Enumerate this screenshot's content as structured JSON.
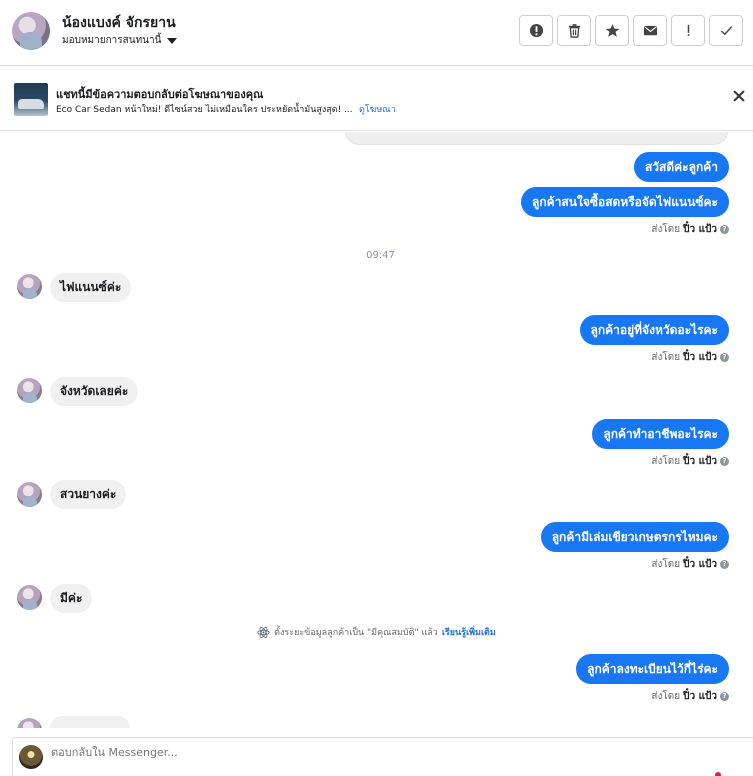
{
  "header": {
    "name": "น้องแบงค์ จักรยาน",
    "assign_label": "มอบหมายการสนทนานี้",
    "actions": [
      {
        "name": "report-icon",
        "label": "!"
      },
      {
        "name": "trash-icon",
        "label": "🗑"
      },
      {
        "name": "star-icon",
        "label": "★"
      },
      {
        "name": "mail-icon",
        "label": "✉"
      },
      {
        "name": "exclamation-icon",
        "label": "!"
      },
      {
        "name": "check-icon",
        "label": "✓"
      }
    ]
  },
  "ad": {
    "title": "แชทนี้มีข้อความตอบกลับต่อโฆษณาของคุณ",
    "subtitle": "Eco Car Sedan หน้าใหม่! ดีไซน์สวย ไม่เหมือนใคร ประหยัดน้ำมันสูงสุด! ...",
    "link": "ดูโฆษณา"
  },
  "chat": {
    "sent_by_prefix": "ส่งโดย",
    "sender": "ปิ๋ว แป้ว",
    "time_divider": "09:47",
    "messages": [
      {
        "dir": "out",
        "text": "สวัสดีค่ะลูกค้า"
      },
      {
        "dir": "out",
        "text": "ลูกค้าสนใจซื้อสดหรือจัดไฟแนนซ์คะ"
      },
      {
        "dir": "in",
        "text": "ไฟแนนซ์ค่ะ"
      },
      {
        "dir": "out",
        "text": "ลูกค้าอยู่ที่จังหวัดอะไรคะ"
      },
      {
        "dir": "in",
        "text": "จังหวัดเลยค่ะ"
      },
      {
        "dir": "out",
        "text": "ลูกค้าทำอาชีพอะไรคะ"
      },
      {
        "dir": "in",
        "text": "สวนยางค่ะ"
      },
      {
        "dir": "out",
        "text": "ลูกค้ามีเล่มเขียวเกษตรกรไหมคะ"
      },
      {
        "dir": "in",
        "text": "มีค่ะ"
      },
      {
        "dir": "out",
        "text": "ลูกค้าลงทะเบียนไว้กี่ไร่คะ"
      }
    ],
    "system_note": {
      "text": "ตั้งระยะข้อมูลลูกค้าเป็น \"มีคุณสมบัติ\" แล้ว",
      "link": "เรียนรู้เพิ่มเติม"
    }
  },
  "composer": {
    "placeholder": "ตอบกลับใน Messenger..."
  },
  "colors": {
    "accent": "#1877f2",
    "incoming_bubble": "#f0f0f0",
    "link": "#216fdb"
  }
}
